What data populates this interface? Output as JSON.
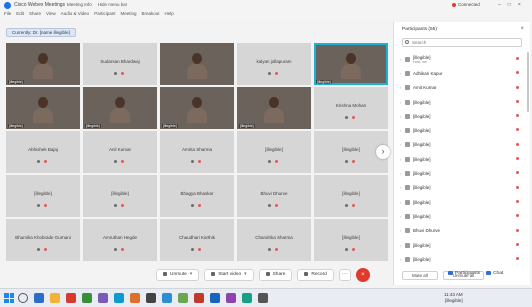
{
  "window": {
    "title": "Cisco Webex Meetings",
    "nav_items": [
      "Meeting Info",
      "Hide menu bar"
    ],
    "menu": [
      "File",
      "Edit",
      "Share",
      "View",
      "Audio & Video",
      "Participant",
      "Meeting",
      "Breakout",
      "Help"
    ],
    "connection_label": "Connected",
    "controls": [
      "–",
      "□",
      "×"
    ]
  },
  "speaker_banner": "Currently: Dr. [name illegible]",
  "grid": {
    "tiles": [
      {
        "kind": "video",
        "bg": "bg-room1",
        "name": "[illegible]"
      },
      {
        "kind": "name",
        "name": "Sudarsan Bhardwaj"
      },
      {
        "kind": "video",
        "bg": "bg-room2",
        "name": ""
      },
      {
        "kind": "name",
        "name": "kalyan jollapuram"
      },
      {
        "kind": "video",
        "bg": "bg-room3",
        "name": "[illegible]",
        "active": true
      },
      {
        "kind": "video",
        "bg": "bg-room4",
        "name": "[illegible]"
      },
      {
        "kind": "video",
        "bg": "bg-room5",
        "name": "[illegible]"
      },
      {
        "kind": "video",
        "bg": "bg-room6",
        "name": "[illegible]"
      },
      {
        "kind": "video",
        "bg": "bg-room8",
        "name": "[illegible]"
      },
      {
        "kind": "name",
        "name": "Krishna Mohan"
      },
      {
        "kind": "name",
        "name": "Abhishek Bajaj"
      },
      {
        "kind": "name",
        "name": "Anil Kumar"
      },
      {
        "kind": "name",
        "name": "Amrita Sharma"
      },
      {
        "kind": "name",
        "name": "[illegible]"
      },
      {
        "kind": "name",
        "name": "[illegible]"
      },
      {
        "kind": "name",
        "name": "[illegible]"
      },
      {
        "kind": "name",
        "name": "[illegible]"
      },
      {
        "kind": "name",
        "name": "Bhagya Bhaskar"
      },
      {
        "kind": "name",
        "name": "Bhuvi Dhurve"
      },
      {
        "kind": "name",
        "name": "[illegible]"
      },
      {
        "kind": "name",
        "name": "Bhumika Khobrade Gurnani"
      },
      {
        "kind": "name",
        "name": "Amruthan Hegde"
      },
      {
        "kind": "name",
        "name": "Chaudhari Karthik"
      },
      {
        "kind": "name",
        "name": "Chandrika Sharma"
      },
      {
        "kind": "name",
        "name": "[illegible]"
      }
    ],
    "next_arrow": "›"
  },
  "panel": {
    "title": "Participants (55)",
    "search_placeholder": "Search",
    "participants": [
      {
        "name": "[illegible]",
        "sub": "Host, me"
      },
      {
        "name": "Adhikari Kapur",
        "sub": ""
      },
      {
        "name": "Amit Kumar",
        "sub": ""
      },
      {
        "name": "[illegible]",
        "sub": ""
      },
      {
        "name": "[illegible]",
        "sub": ""
      },
      {
        "name": "[illegible]",
        "sub": ""
      },
      {
        "name": "[illegible]",
        "sub": ""
      },
      {
        "name": "[illegible]",
        "sub": ""
      },
      {
        "name": "[illegible]",
        "sub": ""
      },
      {
        "name": "[illegible]",
        "sub": ""
      },
      {
        "name": "[illegible]",
        "sub": ""
      },
      {
        "name": "[illegible]",
        "sub": ""
      },
      {
        "name": "Bhuvi Dhurve",
        "sub": ""
      },
      {
        "name": "[illegible]",
        "sub": ""
      },
      {
        "name": "[illegible]",
        "sub": ""
      }
    ],
    "mute_all": "Mute all",
    "unmute_all": "Unmute all"
  },
  "toolbar": {
    "unmute": "Unmute",
    "stop_video": "Start video",
    "share": "Share",
    "record": "Record",
    "more": "···",
    "end": "×"
  },
  "right_tools": {
    "participants": "Participants",
    "chat": "Chat"
  },
  "taskbar": {
    "time": "11:43 AM",
    "date": "[illegible]",
    "app_colors": [
      "#2a6ec7",
      "#f2b233",
      "#d93a2b",
      "#3a8d3a",
      "#7b5ab5",
      "#0e9ad3",
      "#e06e2b",
      "#444444",
      "#2b8fd6",
      "#6aa84f",
      "#c0392b",
      "#1565c0",
      "#8e44ad",
      "#16a085",
      "#555555"
    ]
  }
}
